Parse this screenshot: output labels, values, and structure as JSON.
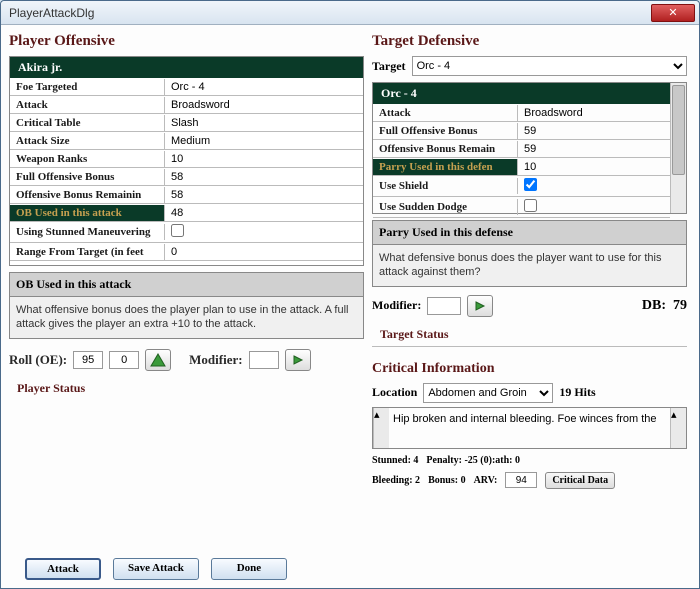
{
  "window": {
    "title": "PlayerAttackDlg"
  },
  "offense": {
    "title": "Player Offensive",
    "character": "Akira jr.",
    "rows": [
      {
        "label": "Foe Targeted",
        "value": "Orc - 4"
      },
      {
        "label": "Attack",
        "value": "Broadsword"
      },
      {
        "label": "Critical Table",
        "value": "Slash"
      },
      {
        "label": "Attack Size",
        "value": "Medium"
      },
      {
        "label": "Weapon Ranks",
        "value": "10"
      },
      {
        "label": "Full Offensive Bonus",
        "value": "58"
      },
      {
        "label": "Offensive Bonus Remainin",
        "value": "58"
      },
      {
        "label": "OB Used in this attack",
        "value": "48",
        "highlight": true
      },
      {
        "label": "Using Stunned Maneuvering",
        "value": "",
        "checkbox": true,
        "checked": false
      },
      {
        "label": "Range From Target  (in feet",
        "value": "0"
      }
    ],
    "hint": {
      "title": "OB Used in this attack",
      "body": "What offensive bonus does the player plan to use in the attack. A full attack gives the player an extra +10 to the attack."
    },
    "roll": {
      "label": "Roll (OE):",
      "v1": "95",
      "v2": "0",
      "modLabel": "Modifier:"
    },
    "status": "Player Status",
    "buttons": {
      "attack": "Attack",
      "save": "Save Attack",
      "done": "Done"
    }
  },
  "defense": {
    "title": "Target Defensive",
    "targetLabel": "Target",
    "targetValue": "Orc - 4",
    "character": "Orc - 4",
    "rows": [
      {
        "label": "Attack",
        "value": "Broadsword"
      },
      {
        "label": "Full Offensive Bonus",
        "value": "59"
      },
      {
        "label": "Offensive Bonus Remain",
        "value": "59"
      },
      {
        "label": "Parry Used in this defen",
        "value": "10",
        "highlight": true
      },
      {
        "label": "Use Shield",
        "value": "",
        "checkbox": true,
        "checked": true
      },
      {
        "label": "Use Sudden Dodge",
        "value": "",
        "checkbox": true,
        "checked": false
      }
    ],
    "hint": {
      "title": "Parry Used in this defense",
      "body": "What defensive bonus does the player want to use for this attack against them?"
    },
    "modLabel": "Modifier:",
    "dbLabel": "DB:",
    "dbValue": "79",
    "status": "Target Status"
  },
  "crit": {
    "title": "Critical Information",
    "locLabel": "Location",
    "locValue": "Abdomen and Groin",
    "hits": "19 Hits",
    "text": "Hip broken and internal bleeding. Foe winces from the",
    "stats": {
      "stunned": "Stunned:  4",
      "penalty": "Penalty:  -25 (0):ath:  0",
      "bleeding": "Bleeding:  2",
      "bonus": "Bonus:    0",
      "arvLabel": "ARV:",
      "arvValue": "94",
      "btn": "Critical Data"
    }
  }
}
